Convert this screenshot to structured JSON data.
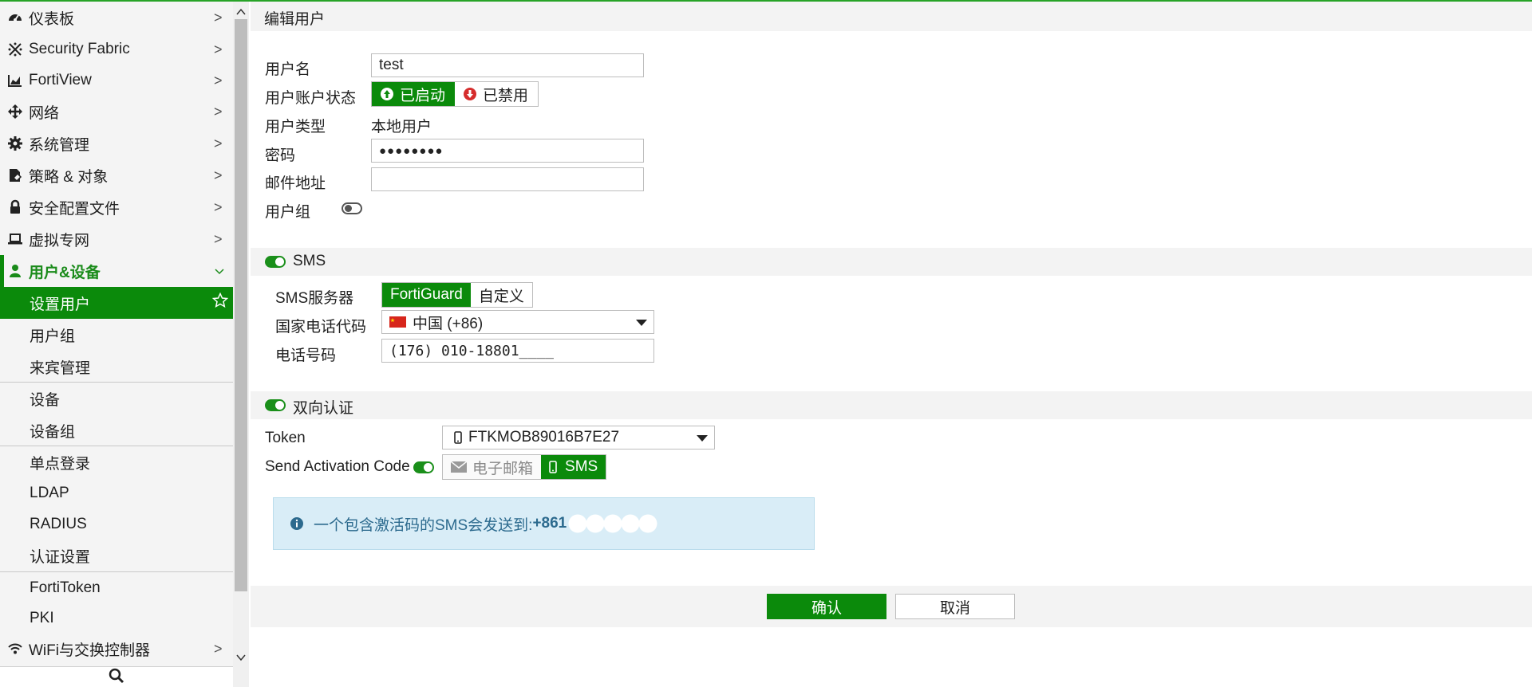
{
  "sidebar": {
    "items": [
      {
        "label": "仪表板",
        "icon": "dashboard-icon"
      },
      {
        "label": "Security Fabric",
        "icon": "security-fabric-icon"
      },
      {
        "label": "FortiView",
        "icon": "chart-icon"
      },
      {
        "label": "网络",
        "icon": "network-arrows-icon"
      },
      {
        "label": "系统管理",
        "icon": "gear-icon"
      },
      {
        "label": "策略 & 对象",
        "icon": "policy-icon"
      },
      {
        "label": "安全配置文件",
        "icon": "lock-icon"
      },
      {
        "label": "虚拟专网",
        "icon": "laptop-icon"
      },
      {
        "label": "用户&设备",
        "icon": "user-icon"
      }
    ],
    "sub_items": [
      "设置用户",
      "用户组",
      "来宾管理",
      "设备",
      "设备组",
      "单点登录",
      "LDAP",
      "RADIUS",
      "认证设置",
      "FortiToken",
      "PKI"
    ],
    "bottom_item": {
      "label": "WiFi与交换控制器",
      "icon": "wifi-icon"
    }
  },
  "main": {
    "title": "编辑用户",
    "username_label": "用户名",
    "username_value": "test",
    "status_label": "用户账户状态",
    "status_enabled": "已启动",
    "status_disabled": "已禁用",
    "type_label": "用户类型",
    "type_value": "本地用户",
    "password_label": "密码",
    "password_value": "●●●●●●●●",
    "email_label": "邮件地址",
    "email_value": "",
    "group_label": "用户组",
    "sms": {
      "header": "SMS",
      "server_label": "SMS服务器",
      "server_fortiguard": "FortiGuard",
      "server_custom": "自定义",
      "country_label": "国家电话代码",
      "country_value": "中国 (+86)",
      "phone_label": "电话号码",
      "phone_value": "(176) 010-18801____"
    },
    "two_factor": {
      "header": "双向认证",
      "token_label": "Token",
      "token_value": "FTKMOB89016B7E27",
      "send_label": "Send Activation Code",
      "email_option": "电子邮箱",
      "sms_option": "SMS",
      "info_text": "一个包含激活码的SMS会发送到: ",
      "info_number": "+861"
    },
    "ok_button": "确认",
    "cancel_button": "取消"
  },
  "colors": {
    "accent": "#0b8a0b",
    "info_bg": "#d9edf7",
    "info_text": "#2c6a8e"
  }
}
